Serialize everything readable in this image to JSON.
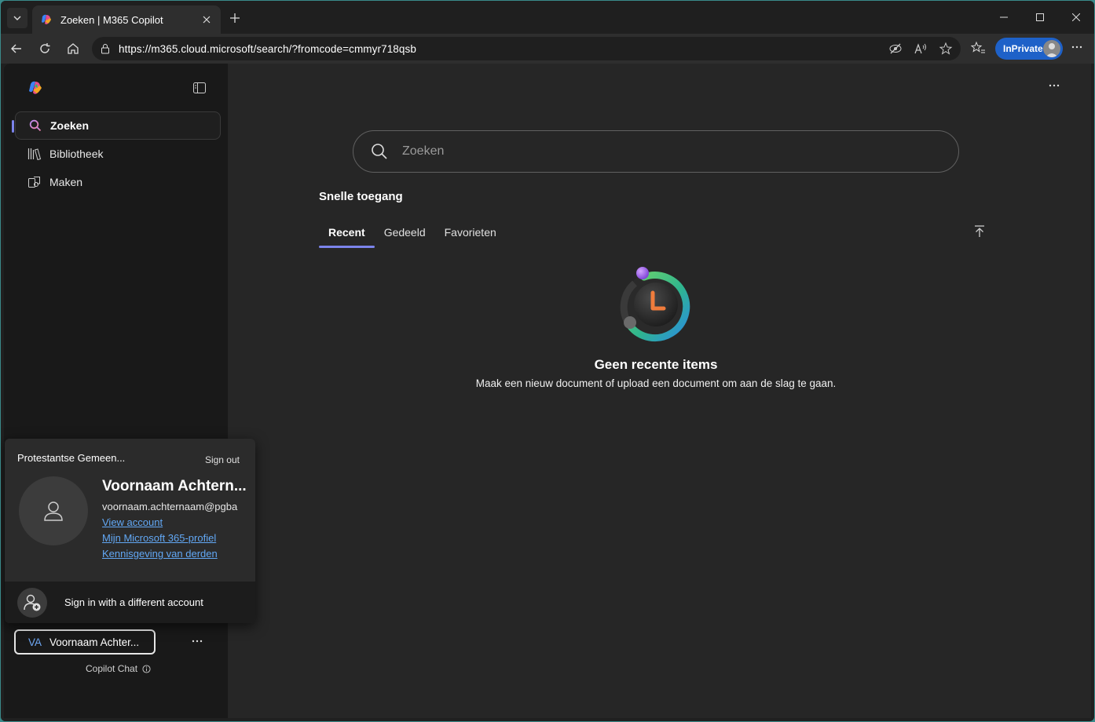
{
  "browser": {
    "tab_title": "Zoeken | M365 Copilot",
    "url": "https://m365.cloud.microsoft/search/?fromcode=cmmyr718qsb",
    "inprivate_label": "InPrivate"
  },
  "sidebar": {
    "items": [
      {
        "label": "Zoeken",
        "icon": "search-icon",
        "active": true
      },
      {
        "label": "Bibliotheek",
        "icon": "library-icon",
        "active": false
      },
      {
        "label": "Maken",
        "icon": "create-icon",
        "active": false
      }
    ],
    "account_button": {
      "initials": "VA",
      "name": "Voornaam Achter..."
    },
    "copilot_chat_label": "Copilot Chat"
  },
  "account_popup": {
    "org_name": "Protestantse Gemeen...",
    "sign_out": "Sign out",
    "display_name": "Voornaam Achtern...",
    "email": "voornaam.achternaam@pgba",
    "links": [
      "View account",
      "Mijn Microsoft 365-profiel",
      "Kennisgeving van derden"
    ],
    "different_account": "Sign in with a different account"
  },
  "main": {
    "search_placeholder": "Zoeken",
    "quick_access_title": "Snelle toegang",
    "tabs": [
      "Recent",
      "Gedeeld",
      "Favorieten"
    ],
    "active_tab": "Recent",
    "empty_title": "Geen recente items",
    "empty_subtitle": "Maak een nieuw document of upload een document om aan de slag te gaan."
  },
  "colors": {
    "accent": "#7b83eb",
    "link": "#62a8f5",
    "inprivate": "#1e61c8"
  }
}
